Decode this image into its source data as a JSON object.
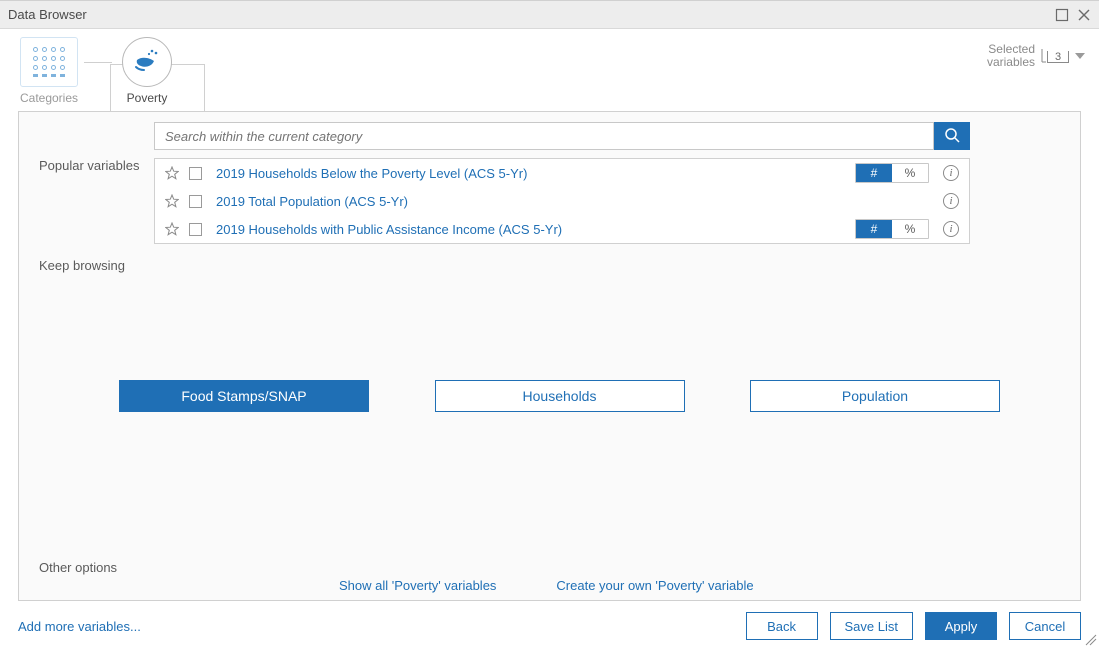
{
  "window": {
    "title": "Data Browser"
  },
  "crumbs": {
    "categories": "Categories",
    "poverty": "Poverty"
  },
  "selected": {
    "label_line1": "Selected",
    "label_line2": "variables",
    "count": "3"
  },
  "search": {
    "placeholder": "Search within the current category"
  },
  "sections": {
    "popular": "Popular variables",
    "browse": "Keep browsing",
    "other": "Other options"
  },
  "variables": [
    {
      "name": "2019 Households Below the Poverty Level (ACS 5-Yr)",
      "has_toggle": true,
      "num": "#",
      "pct": "%"
    },
    {
      "name": "2019 Total Population (ACS 5-Yr)",
      "has_toggle": false
    },
    {
      "name": "2019 Households with Public Assistance Income (ACS 5-Yr)",
      "has_toggle": true,
      "num": "#",
      "pct": "%"
    }
  ],
  "browse_buttons": [
    {
      "label": "Food Stamps/SNAP",
      "style": "primary"
    },
    {
      "label": "Households",
      "style": "outline"
    },
    {
      "label": "Population",
      "style": "outline"
    }
  ],
  "other_links": {
    "show_all": "Show all 'Poverty' variables",
    "create": "Create your own 'Poverty' variable"
  },
  "footer": {
    "add_more": "Add more variables...",
    "back": "Back",
    "save": "Save List",
    "apply": "Apply",
    "cancel": "Cancel"
  }
}
